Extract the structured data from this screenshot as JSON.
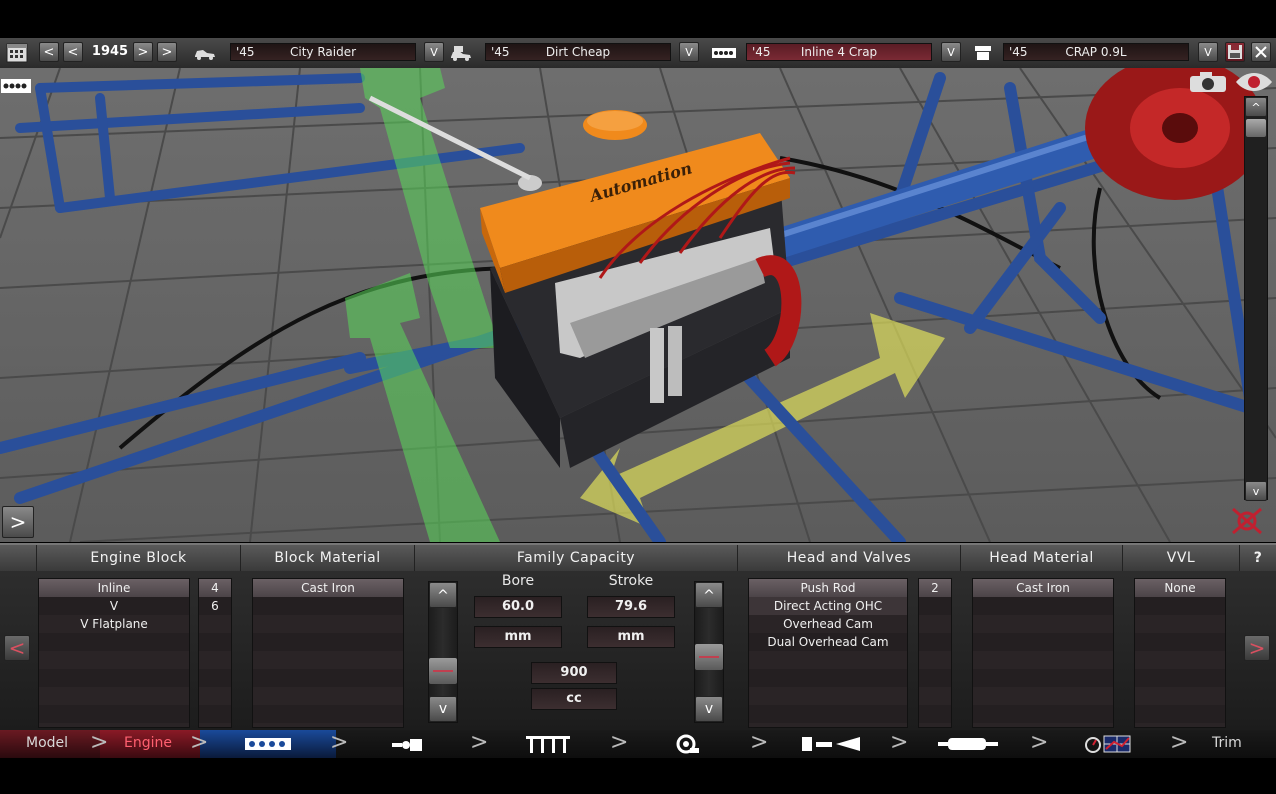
{
  "topbar": {
    "year": "1945",
    "car": {
      "year": "'45",
      "name": "City Raider"
    },
    "trim": {
      "year": "'45",
      "name": "Dirt Cheap"
    },
    "engine_family": {
      "year": "'45",
      "name": "Inline 4 Crap"
    },
    "engine_variant": {
      "year": "'45",
      "name": "CRAP 0.9L"
    },
    "prev": "<",
    "next": ">",
    "dropdown": "V"
  },
  "scene": {
    "engine_logo": "Automation",
    "colors": {
      "engine_cover": "#f08a1c",
      "frame": "#2a4f9a",
      "arrow_green": "#5ad85a",
      "arrow_yellow": "#e8e85a",
      "flywheel": "#b01818"
    }
  },
  "panel": {
    "sections": {
      "engine_block": "Engine Block",
      "block_material": "Block Material",
      "family_capacity": "Family Capacity",
      "head_and_valves": "Head and Valves",
      "head_material": "Head Material",
      "vvl": "VVL",
      "help": "?"
    },
    "engine_block": {
      "layouts": [
        "Inline",
        "V",
        "V Flatplane"
      ],
      "cylinders": [
        "4",
        "6"
      ]
    },
    "block_material": {
      "options": [
        "Cast Iron"
      ]
    },
    "capacity": {
      "bore_label": "Bore",
      "stroke_label": "Stroke",
      "bore": "60.0",
      "stroke": "79.6",
      "bore_unit": "mm",
      "stroke_unit": "mm",
      "displacement": "900",
      "displacement_unit": "cc",
      "up": "^",
      "down": "v"
    },
    "head_and_valves": {
      "options": [
        "Push Rod",
        "Direct Acting OHC",
        "Overhead Cam",
        "Dual Overhead Cam"
      ],
      "valves": [
        "2"
      ]
    },
    "head_material": {
      "options": [
        "Cast Iron"
      ]
    },
    "vvl": {
      "options": [
        "None"
      ]
    },
    "left": "<",
    "right": ">"
  },
  "nav": {
    "model": "Model",
    "engine": "Engine",
    "trim": "Trim",
    "chevron": ">"
  },
  "scene_controls": {
    "expand": ">",
    "scroll_up": "^",
    "scroll_down": "v"
  }
}
